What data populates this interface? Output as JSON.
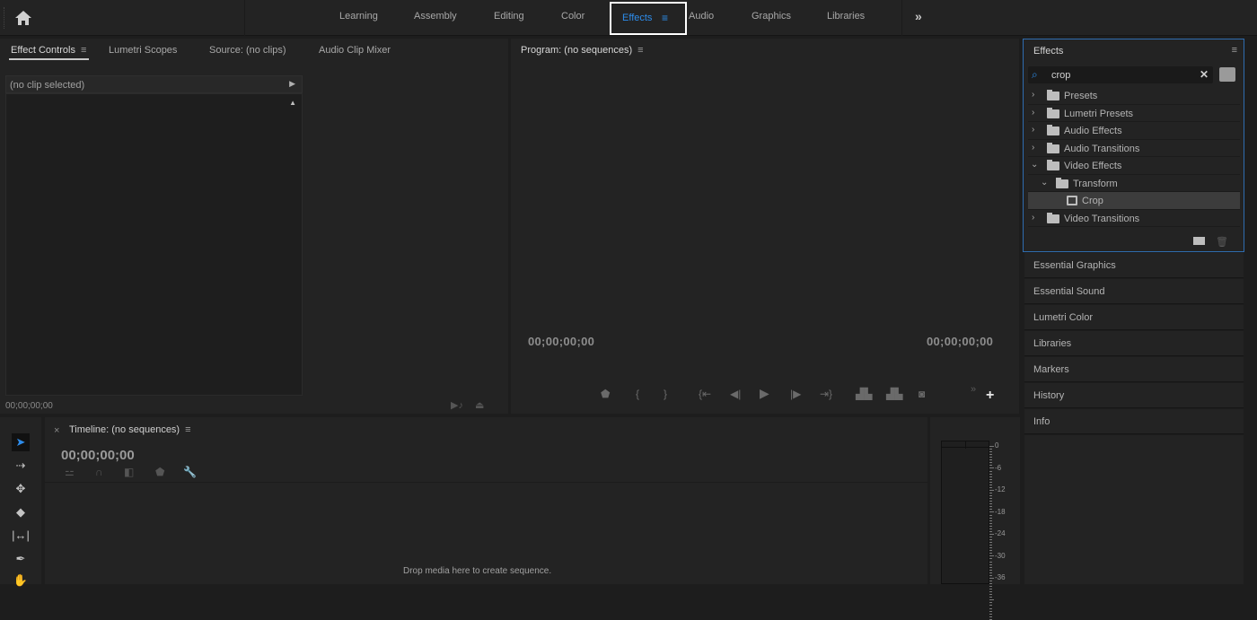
{
  "workspaces": {
    "tabs": [
      "Learning",
      "Assembly",
      "Editing",
      "Color",
      "Effects",
      "Audio",
      "Graphics",
      "Libraries"
    ],
    "active": "Effects",
    "more_label": "»"
  },
  "effect_controls_panel": {
    "tabs": [
      "Effect Controls",
      "Lumetri Scopes",
      "Source: (no clips)",
      "Audio Clip Mixer"
    ],
    "active_tab": "Effect Controls",
    "clip_label": "(no clip selected)",
    "timecode": "00;00;00;00"
  },
  "program_panel": {
    "title": "Program: (no sequences)",
    "timecode_left": "00;00;00;00",
    "timecode_right": "00;00;00;00",
    "transport_icons": [
      "marker-icon",
      "mark-in-icon",
      "mark-out-icon",
      "go-to-in-icon",
      "step-back-icon",
      "play-icon",
      "step-forward-icon",
      "go-to-out-icon",
      "lift-icon",
      "extract-icon",
      "export-frame-icon"
    ]
  },
  "effects_panel": {
    "title": "Effects",
    "search_value": "crop",
    "search_placeholder": "",
    "tree": [
      {
        "label": "Presets",
        "level": 0,
        "expanded": false,
        "type": "preset-folder"
      },
      {
        "label": "Lumetri Presets",
        "level": 0,
        "expanded": false,
        "type": "preset-folder"
      },
      {
        "label": "Audio Effects",
        "level": 0,
        "expanded": false,
        "type": "folder"
      },
      {
        "label": "Audio Transitions",
        "level": 0,
        "expanded": false,
        "type": "folder"
      },
      {
        "label": "Video Effects",
        "level": 0,
        "expanded": true,
        "type": "folder"
      },
      {
        "label": "Transform",
        "level": 1,
        "expanded": true,
        "type": "folder"
      },
      {
        "label": "Crop",
        "level": 2,
        "selected": true,
        "type": "effect"
      },
      {
        "label": "Video Transitions",
        "level": 0,
        "expanded": false,
        "type": "folder"
      }
    ]
  },
  "right_panels": [
    "Essential Graphics",
    "Essential Sound",
    "Lumetri Color",
    "Libraries",
    "Markers",
    "History",
    "Info"
  ],
  "timeline_panel": {
    "title": "Timeline: (no sequences)",
    "timecode": "00;00;00;00",
    "drop_hint": "Drop media here to create sequence."
  },
  "tools": [
    "selection-tool",
    "track-select-tool",
    "ripple-edit-tool",
    "razor-tool",
    "slip-tool",
    "pen-tool",
    "hand-tool"
  ],
  "audio_meter": {
    "labels": [
      "0",
      "-6",
      "-12",
      "-18",
      "-24",
      "-30",
      "-36"
    ]
  }
}
